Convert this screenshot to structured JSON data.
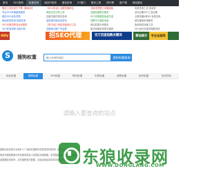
{
  "topnav": {
    "items": [
      "首页",
      "SEO查询",
      "权重查询",
      "域名IP查询",
      "爱站查询",
      "IP/端口",
      "更多工具",
      "排行榜",
      "客户端",
      "网站建设"
    ]
  },
  "links": {
    "rows": [
      [
        {
          "text": "爱站工具包官方下载【新版本】",
          "color": "red"
        },
        {
          "text": "【SEO优化】百度快速排名",
          "color": "red"
        },
        {
          "text": "关键词挖掘工具箱新版",
          "color": "red"
        },
        {
          "text": "收录查询工具 批量查",
          "color": "gray"
        }
      ],
      [
        {
          "text": "专业SEO外链建设服务",
          "color": "blue"
        },
        {
          "text": "网站日志分析工具",
          "color": "green"
        },
        {
          "text": "百度权重提升服务",
          "color": "green"
        },
        {
          "text": "站长必备SEO工具合集",
          "color": "gray"
        }
      ],
      [
        {
          "text": "爱站SEO优化学院",
          "color": "blue"
        },
        {
          "text": "百度关键词排名查询",
          "color": "gray"
        },
        {
          "text": "SEO诊断报告免费生成",
          "color": "green"
        },
        {
          "text": "云服务器4核8G 免费试用",
          "color": "gray"
        }
      ],
      [
        {
          "text": "网站收录查询 批量查询",
          "color": "blue"
        },
        {
          "text": "高质量外链自动发布",
          "color": "blue"
        },
        {
          "text": "站群SEO建站系统",
          "color": "green"
        },
        {
          "text": "域名备案查询服务",
          "color": "gray"
        }
      ],
      [
        {
          "text": "SEO关键词排名优化服务",
          "color": "red"
        },
        {
          "text": "【多平台】网站流量统计工具",
          "color": "red"
        },
        {
          "text": "网站权重分析报告",
          "color": "gray"
        },
        {
          "text": "免费网站测速工具",
          "color": "gray"
        }
      ],
      [
        {
          "text": "SEO在线诊断 流量分析",
          "color": "blue"
        },
        {
          "text": "百度竞价推广代运营",
          "color": "blue"
        },
        {
          "text": "新站快速收录提交通道",
          "color": "gray"
        },
        {
          "text": "SEO优化关键词指数查询",
          "color": "gray"
        }
      ]
    ]
  },
  "banners": {
    "b1": "ddy",
    "b2": "招SEO代理",
    "b3": "百万百度指数关键词",
    "b4_left": "爱站统计",
    "b4_right": "专业全面网"
  },
  "search": {
    "logo_letter": "S",
    "logo_text": "搜狗权重",
    "placeholder": "输入查询的域名",
    "button": "搜狗权重查询"
  },
  "tabs": [
    "综合权重",
    "搜狗权重",
    "360权重",
    "神马权重",
    "头条权重",
    "谷歌权重",
    "历史权重",
    "历史排名"
  ],
  "active_tab": 1,
  "hint": "请输入要查询的站点",
  "footer": {
    "lines": [
      "搜狗站长权重平台是什么？网站在搜狗中的权重怎样查询？这里可以帮你快速查询",
      "网站在搜狗搜索中的关键词排名以及预估流量数据，权重值越高代表网站流量越大",
      "该数据仅供参考，并非搜狗官方数据，请结合网站实际情况综合分析使用"
    ]
  },
  "watermark": {
    "text": "东狼收录网",
    "url": "WWW.DONGLANG.COM"
  },
  "colors": {
    "accent": "#2a8be0",
    "nav_bg": "#2b3036",
    "red": "#e03a3a",
    "blue": "#2a6fd6",
    "green": "#2c9a3c"
  }
}
